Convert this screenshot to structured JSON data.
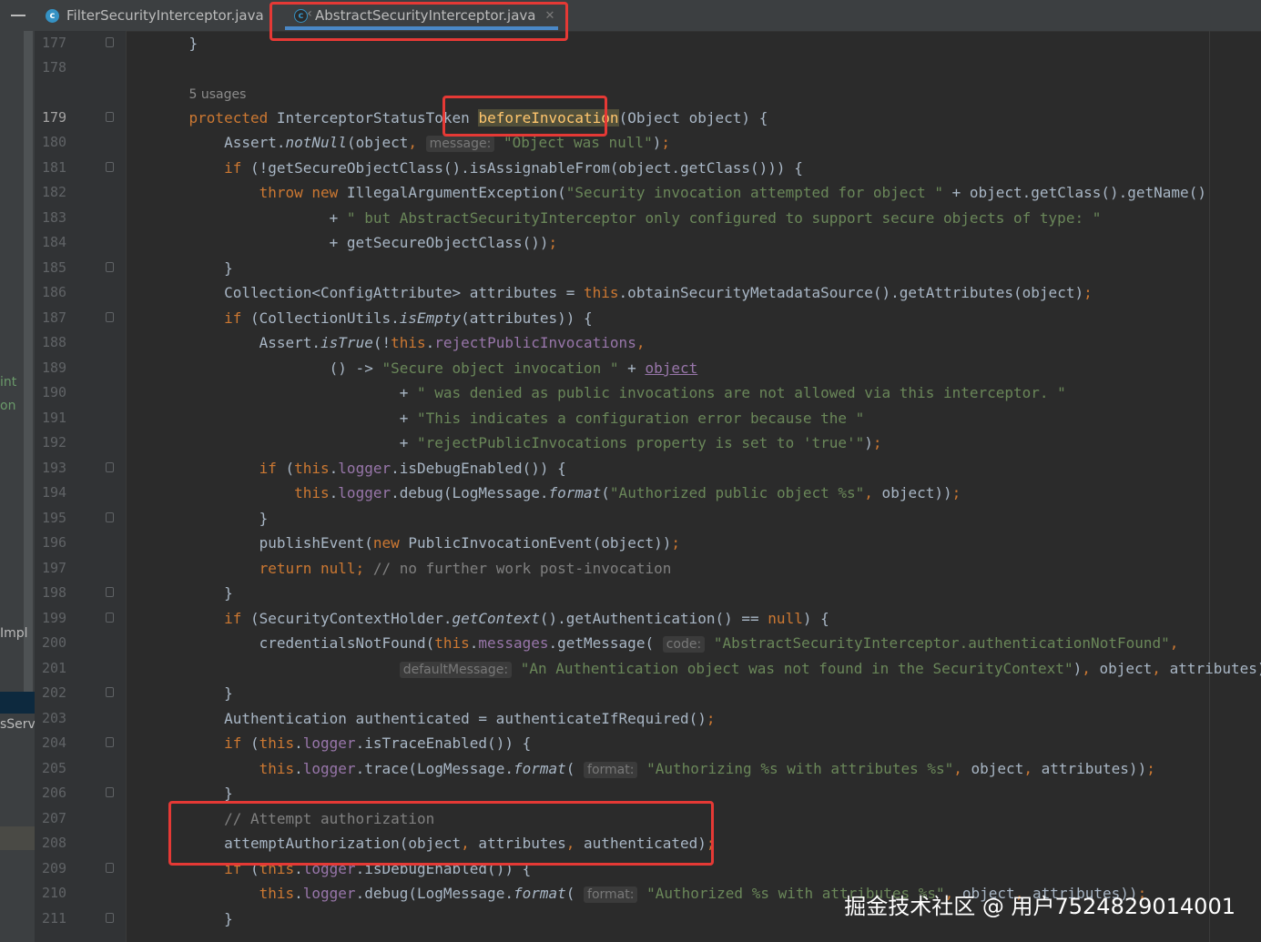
{
  "tabs": [
    {
      "label": "FilterSecurityInterceptor.java",
      "icon": "class-icon",
      "active": false
    },
    {
      "label": "AbstractSecurityInterceptor.java",
      "icon": "abstract-class-icon",
      "active": true
    }
  ],
  "left_panel": {
    "fragments": [
      "int",
      "on",
      "Impl",
      "sServ"
    ]
  },
  "usages_hint": "5 usages",
  "hints": {
    "message": "message:",
    "code": "code:",
    "defaultMessage": "defaultMessage:",
    "format": "format:"
  },
  "strings": {
    "s180": "\"Object was null\"",
    "s182": "\"Security invocation attempted for object \"",
    "s183": "\" but AbstractSecurityInterceptor only configured to support secure objects of type: \"",
    "s189": "\"Secure object invocation \"",
    "s190": "\" was denied as public invocations are not allowed via this interceptor. \"",
    "s191": "\"This indicates a configuration error because the \"",
    "s192": "\"rejectPublicInvocations property is set to 'true'\"",
    "s194": "\"Authorized public object %s\"",
    "s200": "\"AbstractSecurityInterceptor.authenticationNotFound\"",
    "s201": "\"An Authentication object was not found in the SecurityContext\"",
    "s205": "\"Authorizing %s with attributes %s\"",
    "s210": "\"Authorized %s with attributes %s\""
  },
  "comments": {
    "c197": "// no further work post-invocation",
    "c207": "// Attempt authorization"
  },
  "identifiers": {
    "method_name": "beforeInvocation",
    "return_type": "InterceptorStatusToken"
  },
  "line_numbers": [
    "177",
    "178",
    "179",
    "180",
    "181",
    "182",
    "183",
    "184",
    "185",
    "186",
    "187",
    "188",
    "189",
    "190",
    "191",
    "192",
    "193",
    "194",
    "195",
    "196",
    "197",
    "198",
    "199",
    "200",
    "201",
    "202",
    "203",
    "204",
    "205",
    "206",
    "207",
    "208",
    "209",
    "210",
    "211"
  ],
  "watermark": "掘金技术社区 @ 用户7524829014001",
  "colors": {
    "background": "#2b2b2b",
    "keyword": "#cc7832",
    "string": "#6a8759",
    "field": "#9876aa",
    "highlight_box": "#e53935"
  }
}
